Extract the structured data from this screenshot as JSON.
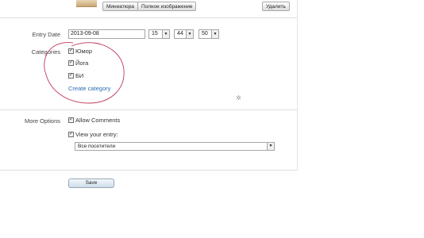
{
  "top_bar": {
    "thumbnail_button": "Миниатюра",
    "full_image_button": "Полное изображение",
    "delete_button": "Удалить"
  },
  "entry_date": {
    "label": "Entry Date",
    "date_value": "2013-09-08",
    "hour": "15",
    "minute": "44",
    "second": "50"
  },
  "categories": {
    "label": "Categories",
    "items": [
      {
        "label": "Юмор",
        "checked": true
      },
      {
        "label": "Йога",
        "checked": true
      },
      {
        "label": "БИ",
        "checked": true
      }
    ],
    "create_link": "Create category"
  },
  "more_options": {
    "label": "More Options",
    "allow_comments": {
      "label": "Allow Comments",
      "checked": true
    },
    "view_entry": {
      "label": "View your entry:",
      "checked": true,
      "selected": "Все посетители"
    }
  },
  "save_button": "Save",
  "colors": {
    "link": "#2a6db3",
    "annotation_circle": "#c0395a",
    "divider": "#dedede"
  }
}
